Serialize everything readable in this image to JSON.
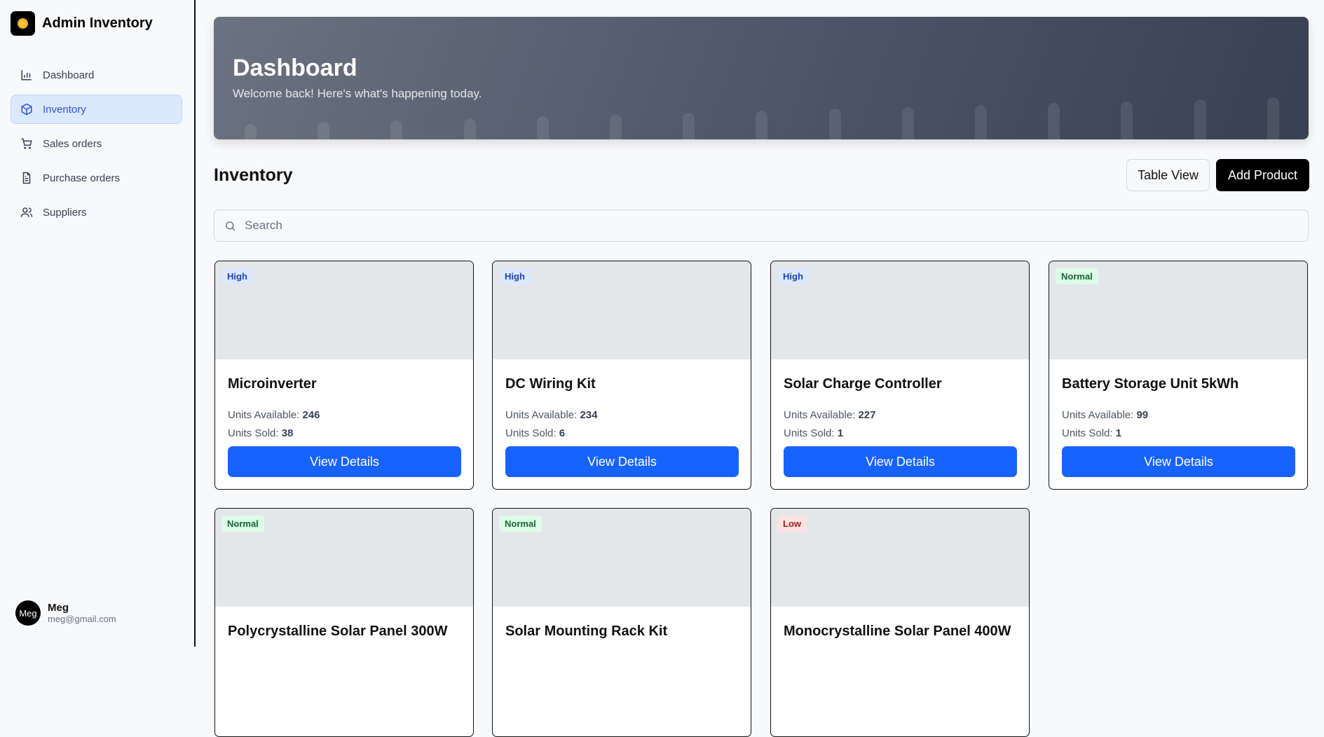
{
  "app": {
    "title": "Admin Inventory"
  },
  "sidebar": {
    "items": [
      {
        "label": "Dashboard",
        "icon": "bar-chart-icon"
      },
      {
        "label": "Inventory",
        "icon": "box-icon",
        "active": true
      },
      {
        "label": "Sales orders",
        "icon": "cart-icon"
      },
      {
        "label": "Purchase orders",
        "icon": "document-icon"
      },
      {
        "label": "Suppliers",
        "icon": "users-icon"
      }
    ],
    "user": {
      "initials": "Meg",
      "name": "Meg",
      "email": "meg@gmail.com"
    }
  },
  "banner": {
    "title": "Dashboard",
    "subtitle": "Welcome back! Here's what's happening today."
  },
  "main": {
    "title": "Inventory",
    "table_view_label": "Table View",
    "add_product_label": "Add Product",
    "search_placeholder": "Search",
    "units_available_label": "Units Available:",
    "units_sold_label": "Units Sold:",
    "view_details_label": "View Details",
    "products": [
      {
        "name": "Microinverter",
        "badge": "High",
        "available": "246",
        "sold": "38"
      },
      {
        "name": "DC Wiring Kit",
        "badge": "High",
        "available": "234",
        "sold": "6"
      },
      {
        "name": "Solar Charge Controller",
        "badge": "High",
        "available": "227",
        "sold": "1"
      },
      {
        "name": "Battery Storage Unit 5kWh",
        "badge": "Normal",
        "available": "99",
        "sold": "1"
      },
      {
        "name": "Polycrystalline Solar Panel 300W",
        "badge": "Normal"
      },
      {
        "name": "Solar Mounting Rack Kit",
        "badge": "Normal"
      },
      {
        "name": "Monocrystalline Solar Panel 400W",
        "badge": "Low"
      }
    ]
  },
  "colors": {
    "accent": "#1863fd",
    "active_nav_bg": "#dbe8fe",
    "high": "#1e40af",
    "normal": "#166534",
    "low": "#991b1b"
  }
}
